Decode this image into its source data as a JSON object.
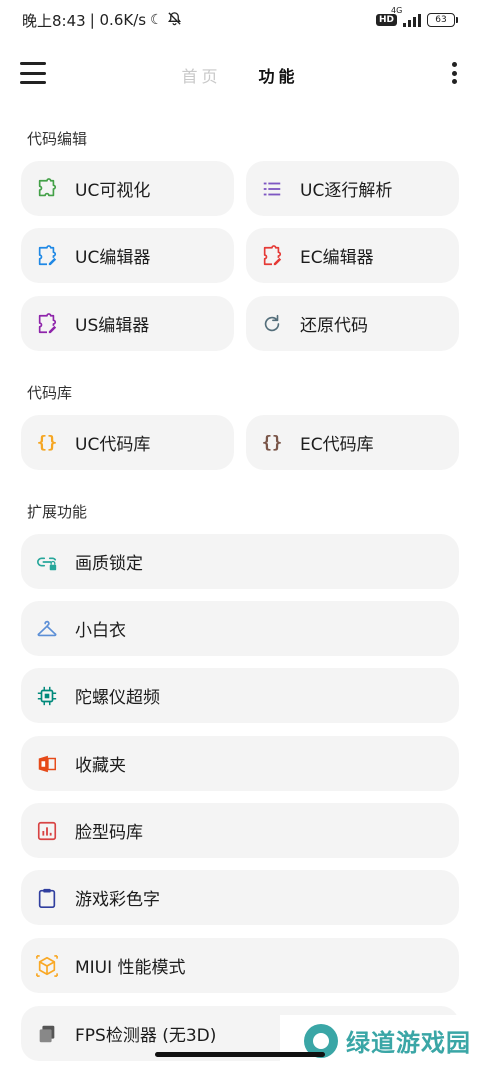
{
  "status_bar": {
    "time": "晚上8:43",
    "net_speed": "| 0.6K/s",
    "hd": "HD",
    "network": "4G",
    "battery": "63"
  },
  "header": {
    "tabs": [
      {
        "label": "首页",
        "active": false
      },
      {
        "label": "功能",
        "active": true
      }
    ]
  },
  "sections": {
    "code_edit": {
      "title": "代码编辑",
      "items": [
        {
          "label": "UC可视化",
          "icon": "puzzle-icon",
          "color": "#43a047"
        },
        {
          "label": "UC逐行解析",
          "icon": "list-icon",
          "color": "#7e57c2"
        },
        {
          "label": "UC编辑器",
          "icon": "puzzle-edit-icon",
          "color": "#1e88e5"
        },
        {
          "label": "EC编辑器",
          "icon": "puzzle-edit-icon",
          "color": "#e53935"
        },
        {
          "label": "US编辑器",
          "icon": "puzzle-edit-icon",
          "color": "#8e24aa"
        },
        {
          "label": "还原代码",
          "icon": "refresh-icon",
          "color": "#546e7a"
        }
      ]
    },
    "code_lib": {
      "title": "代码库",
      "items": [
        {
          "label": "UC代码库",
          "icon": "braces-icon",
          "color": "#f5a623"
        },
        {
          "label": "EC代码库",
          "icon": "braces-icon",
          "color": "#795548"
        }
      ]
    },
    "extensions": {
      "title": "扩展功能",
      "items": [
        {
          "label": "画质锁定",
          "icon": "link-lock-icon",
          "color": "#26a69a"
        },
        {
          "label": "小白衣",
          "icon": "hanger-icon",
          "color": "#5c8fd6"
        },
        {
          "label": "陀螺仪超频",
          "icon": "chip-icon",
          "color": "#00897b"
        },
        {
          "label": "收藏夹",
          "icon": "office-icon",
          "color": "#e64a19"
        },
        {
          "label": "脸型码库",
          "icon": "chart-icon",
          "color": "#d84343"
        },
        {
          "label": "游戏彩色字",
          "icon": "clipboard-icon",
          "color": "#303f9f"
        },
        {
          "label": "MIUI 性能模式",
          "icon": "cube-icon",
          "color": "#f9a825"
        },
        {
          "label": "FPS检测器 (无3D)",
          "icon": "copy-icon",
          "color": "#555555"
        }
      ]
    }
  },
  "watermark": "绿道游戏园"
}
